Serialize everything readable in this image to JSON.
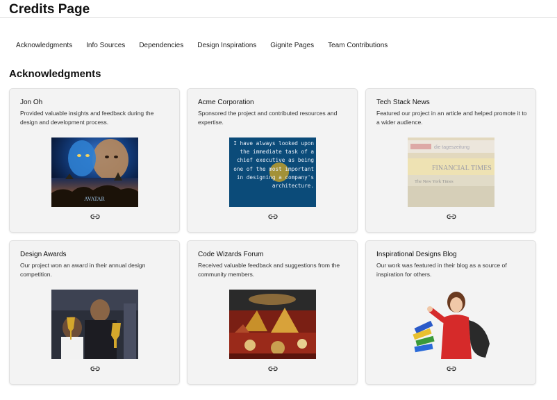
{
  "page": {
    "title": "Credits Page"
  },
  "nav": {
    "items": [
      {
        "label": "Acknowledgments"
      },
      {
        "label": "Info Sources"
      },
      {
        "label": "Dependencies"
      },
      {
        "label": "Design Inspirations"
      },
      {
        "label": "Gignite Pages"
      },
      {
        "label": "Team Contributions"
      }
    ]
  },
  "section": {
    "title": "Acknowledgments"
  },
  "cards": [
    {
      "name": "Jon Oh",
      "description": "Provided valuable insights and feedback during the design and development process.",
      "image_caption": "AVATAR"
    },
    {
      "name": "Acme Corporation",
      "description": "Sponsored the project and contributed resources and expertise.",
      "image_text": "I have always looked upon\nthe immediate task of a\nchief executive as being\none of the most important\nin designing a company's\narchitecture."
    },
    {
      "name": "Tech Stack News",
      "description": "Featured our project in an article and helped promote it to a wider audience.",
      "image_text_1": "die tageszeitung",
      "image_text_2": "FINANCIAL TIMES",
      "image_text_3": "The New York Times"
    },
    {
      "name": "Design Awards",
      "description": "Our project won an award in their annual design competition."
    },
    {
      "name": "Code Wizards Forum",
      "description": "Received valuable feedback and suggestions from the community members."
    },
    {
      "name": "Inspirational Designs Blog",
      "description": "Our work was featured in their blog as a source of inspiration for others."
    }
  ]
}
